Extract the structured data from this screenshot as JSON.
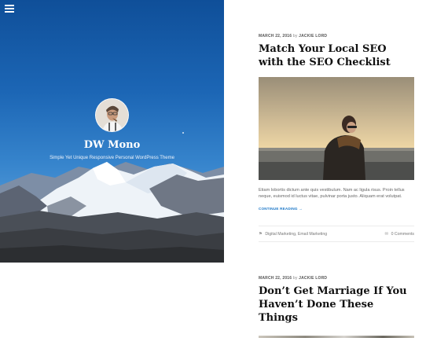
{
  "site": {
    "title": "DW Mono",
    "description": "Simple Yet Unique Responsive Personal WordPress Theme"
  },
  "icons": {
    "menu": "hamburger-menu-icon",
    "tag": "tag-icon",
    "comment": "comment-icon"
  },
  "colors": {
    "accent_link": "#1a76c7",
    "hero_sky_top": "#0f4f99",
    "hero_sky_bottom": "#6ba6d9"
  },
  "posts": [
    {
      "date": "MARCH 22, 2016",
      "by": "by",
      "author": "JACKIE LORD",
      "title": "Match Your Local SEO with the SEO Checklist",
      "excerpt": "Etiam lobortis dictum ante quis vestibulum. Nam ac ligula risus. Proin tellus neque, euismod id luctus vitae, pulvinar porta justo. Aliquam erat volutpat.",
      "continue_label": "CONTINUE READING →",
      "categories": "Digital Marketing, Email Marketing",
      "comments": "0 Comments"
    },
    {
      "date": "MARCH 22, 2016",
      "by": "by",
      "author": "JACKIE LORD",
      "title": "Don’t Get Marriage If You Haven’t Done These Things"
    }
  ]
}
